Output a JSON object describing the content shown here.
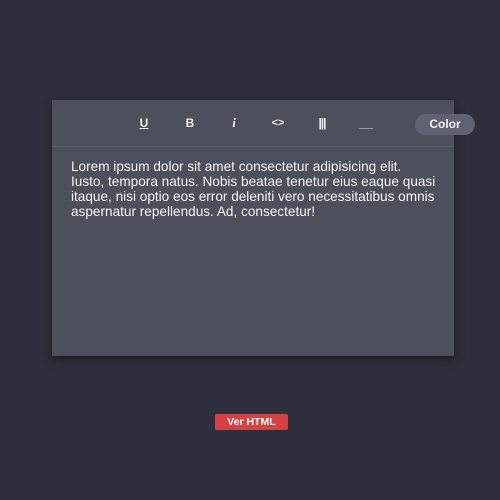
{
  "toolbar": {
    "underline_label": "U",
    "bold_label": "B",
    "italic_label": "i",
    "code_label": "<>",
    "strike_label": "|||",
    "line_label": "__",
    "color_label": "Color"
  },
  "editor": {
    "content": "Lorem ipsum dolor sit amet consectetur adipisicing elit. Iusto, tempora natus. Nobis beatae tenetur eius eaque quasi itaque, nisi optio eos error deleniti vero necessitatibus omnis aspernatur repellendus. Ad, consectetur!"
  },
  "footer": {
    "ver_html_label": "Ver HTML"
  },
  "colors": {
    "background": "#2d303c",
    "editor_bg": "#4c4f5c",
    "color_button_bg": "#5f6271",
    "ver_html_bg": "#d64141"
  }
}
